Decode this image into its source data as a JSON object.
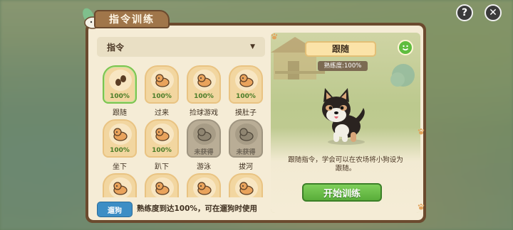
{
  "window": {
    "title": "指令训练",
    "help_label": "?",
    "close_label": "✕"
  },
  "dropdown": {
    "label": "指令",
    "icon": "chevron-down-icon"
  },
  "commands": [
    {
      "name": "跟随",
      "progress": "100%",
      "status": "unlocked",
      "selected": true,
      "icon": "paw-print-icon"
    },
    {
      "name": "过来",
      "progress": "100%",
      "status": "unlocked",
      "selected": false,
      "icon": "dog-running-icon"
    },
    {
      "name": "捡球游戏",
      "progress": "100%",
      "status": "unlocked",
      "selected": false,
      "icon": "dog-ball-icon"
    },
    {
      "name": "摸肚子",
      "progress": "100%",
      "status": "unlocked",
      "selected": false,
      "icon": "dog-belly-icon"
    },
    {
      "name": "坐下",
      "progress": "100%",
      "status": "unlocked",
      "selected": false,
      "icon": "dog-sit-icon"
    },
    {
      "name": "趴下",
      "progress": "100%",
      "status": "unlocked",
      "selected": false,
      "icon": "dog-lie-icon"
    },
    {
      "name": "游泳",
      "progress": "未获得",
      "status": "locked",
      "selected": false,
      "icon": "dog-swim-icon"
    },
    {
      "name": "拔河",
      "progress": "未获得",
      "status": "locked",
      "selected": false,
      "icon": "dog-tug-icon"
    },
    {
      "name": "",
      "progress": "",
      "status": "unlocked",
      "selected": false,
      "icon": "dog-icon"
    },
    {
      "name": "",
      "progress": "",
      "status": "unlocked",
      "selected": false,
      "icon": "dog-icon"
    },
    {
      "name": "",
      "progress": "",
      "status": "unlocked",
      "selected": false,
      "icon": "dog-icon"
    },
    {
      "name": "",
      "progress": "",
      "status": "unlocked",
      "selected": false,
      "icon": "dog-icon"
    }
  ],
  "footer": {
    "walk_button": "遛狗",
    "hint": "熟练度到达100%，可在遛狗时使用"
  },
  "detail": {
    "skill_name": "跟随",
    "proficiency": "熟练度:100%",
    "description": "跟随指令，学会可以在农场将小狗设为跟随。",
    "start_button": "开始训练"
  },
  "colors": {
    "accent_green": "#5fbd3f",
    "panel_brown": "#6b4a2e",
    "paper": "#f5ecd6",
    "progress_green": "#4b7d28",
    "walk_blue": "#3d8ec5"
  }
}
